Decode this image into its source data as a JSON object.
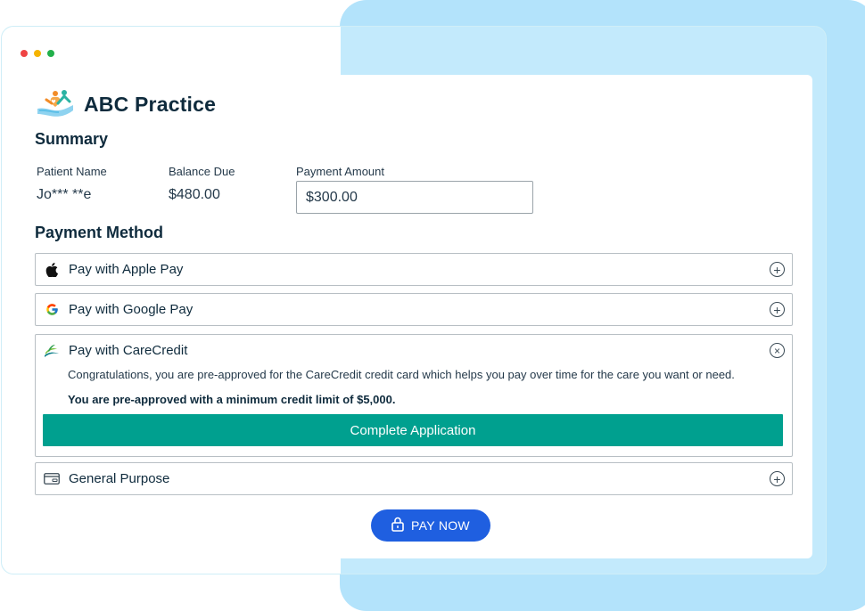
{
  "colors": {
    "backdrop": "#b3e3fb",
    "primary_button": "#1f5fe0",
    "carecredit_button": "#00a08f",
    "text_dark": "#0f2b3d",
    "window_dots": [
      "#ef4444",
      "#f5b400",
      "#22b04b"
    ]
  },
  "practice": {
    "name": "ABC Practice",
    "logo_icon": "caring-hands-logo-icon"
  },
  "summary": {
    "title": "Summary",
    "patient_name_label": "Patient Name",
    "patient_name_value": "Jo*** **e",
    "balance_due_label": "Balance Due",
    "balance_due_value": "$480.00",
    "payment_amount_label": "Payment Amount",
    "payment_amount_value": "$300.00"
  },
  "payment_method": {
    "title": "Payment Method",
    "options": [
      {
        "label": "Pay with Apple Pay",
        "icon": "apple-icon",
        "expanded": false,
        "toggle_icon": "plus-circle-icon"
      },
      {
        "label": "Pay with Google Pay",
        "icon": "google-icon",
        "expanded": false,
        "toggle_icon": "plus-circle-icon"
      },
      {
        "label": "Pay with CareCredit",
        "icon": "carecredit-icon",
        "expanded": true,
        "toggle_icon": "close-circle-icon",
        "description": "Congratulations, you are pre-approved for the CareCredit credit card which helps you pay over time for the care you want or need.",
        "highlight": "You are pre-approved with a minimum credit limit of $5,000.",
        "button_label": "Complete Application"
      },
      {
        "label": "General Purpose",
        "icon": "credit-card-icon",
        "expanded": false,
        "toggle_icon": "plus-circle-icon"
      }
    ]
  },
  "pay_now": {
    "label": "PAY NOW",
    "icon": "lock-icon"
  }
}
